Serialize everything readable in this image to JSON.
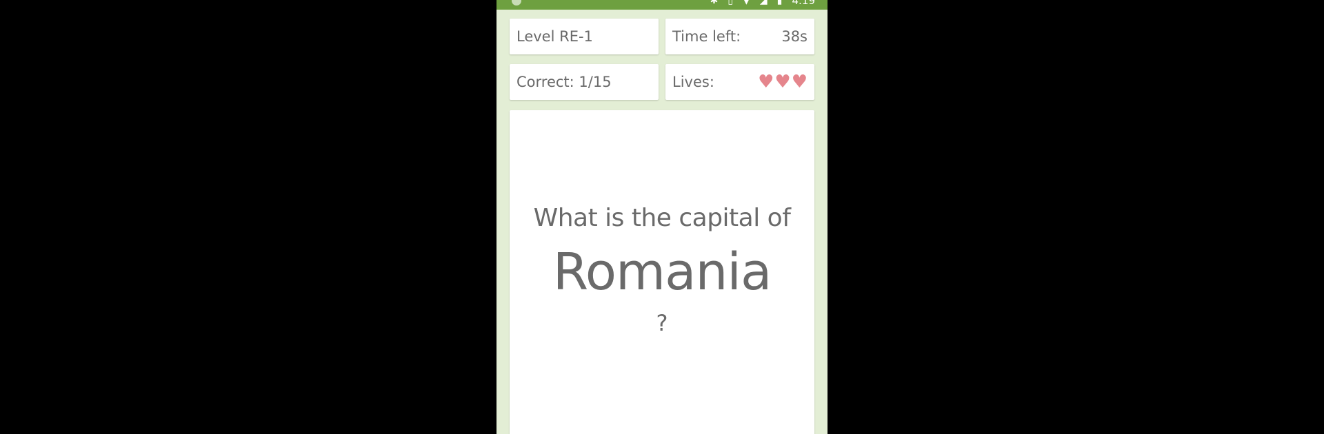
{
  "status_bar": {
    "time": "4:19",
    "icons": [
      "bluetooth-icon",
      "vibrate-icon",
      "wifi-icon",
      "signal-icon",
      "battery-icon"
    ]
  },
  "level": {
    "label": "Level RE-1"
  },
  "timer": {
    "label": "Time left:",
    "value": "38s"
  },
  "score": {
    "label": "Correct: 1/15"
  },
  "lives": {
    "label": "Lives:",
    "count": 3,
    "heart_glyph": "♥"
  },
  "question": {
    "prefix": "What is the capital of",
    "country": "Romania",
    "suffix": "?"
  },
  "colors": {
    "status_bar": "#6ea040",
    "background": "#e3eed5",
    "card": "#ffffff",
    "text": "#6a6a6a",
    "heart": "#e5858c"
  }
}
